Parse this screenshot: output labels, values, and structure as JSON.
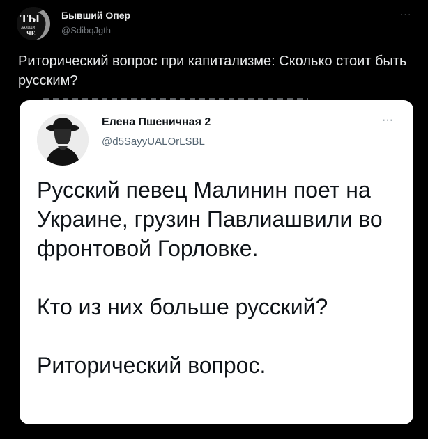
{
  "tweet": {
    "author_name": "Бывший Опер",
    "author_handle": "@SdibqJgth",
    "more_label": "···",
    "avatar_text_big": "ТЫ",
    "avatar_text_small_1": "ЗАХОДИ",
    "avatar_text_small_2": "ЧЕ",
    "text": "Риторический вопрос при капитализме: Сколько стоит быть русским?"
  },
  "quoted": {
    "author_name": "Елена Пшеничная 2",
    "author_handle": "@d5SayyUALOrLSBL",
    "more_label": "···",
    "paragraphs": [
      "Русский певец Малинин поет на Украине, грузин Павлиашвили во фронтовой Горловке.",
      "Кто из них больше русский?",
      "Риторический вопрос."
    ]
  },
  "colors": {
    "background": "#000000",
    "text_primary": "#e7e9ea",
    "text_secondary": "#71767b",
    "card_background": "#ffffff",
    "card_text": "#0f1419",
    "card_secondary": "#536471"
  },
  "icons": {
    "more": "more-horizontal-icon",
    "avatar": "user-avatar-icon"
  }
}
